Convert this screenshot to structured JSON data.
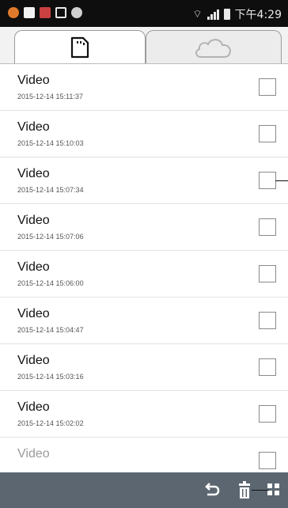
{
  "status_bar": {
    "time": "下午4:29",
    "left_icons": [
      "notification-dot-icon",
      "document-icon",
      "mail-icon",
      "image-icon",
      "sync-icon"
    ],
    "right_icons": [
      "wifi-icon",
      "signal-icon",
      "battery-icon"
    ]
  },
  "tabs": [
    {
      "name": "tab-local",
      "icon": "sd-card-icon",
      "selected": true
    },
    {
      "name": "tab-cloud",
      "icon": "cloud-icon",
      "selected": false
    }
  ],
  "list": {
    "items": [
      {
        "title": "Video",
        "date": "2015-12-14 15:11:37",
        "checked": false
      },
      {
        "title": "Video",
        "date": "2015-12-14 15:10:03",
        "checked": false
      },
      {
        "title": "Video",
        "date": "2015-12-14 15:07:34",
        "checked": false
      },
      {
        "title": "Video",
        "date": "2015-12-14 15:07:06",
        "checked": false
      },
      {
        "title": "Video",
        "date": "2015-12-14 15:06:00",
        "checked": false
      },
      {
        "title": "Video",
        "date": "2015-12-14 15:04:47",
        "checked": false
      },
      {
        "title": "Video",
        "date": "2015-12-14 15:03:16",
        "checked": false
      },
      {
        "title": "Video",
        "date": "2015-12-14 15:02:02",
        "checked": false
      },
      {
        "title": "Video",
        "date": "",
        "checked": false
      }
    ]
  },
  "bottom_bar": {
    "buttons": [
      "back-icon",
      "delete-icon",
      "grid-menu-icon"
    ]
  },
  "colors": {
    "status_bar": "#0e0e0e",
    "bottom_bar": "#5b6670",
    "row_divider": "#e2e2e2",
    "tab_border": "#9b9b9b"
  }
}
